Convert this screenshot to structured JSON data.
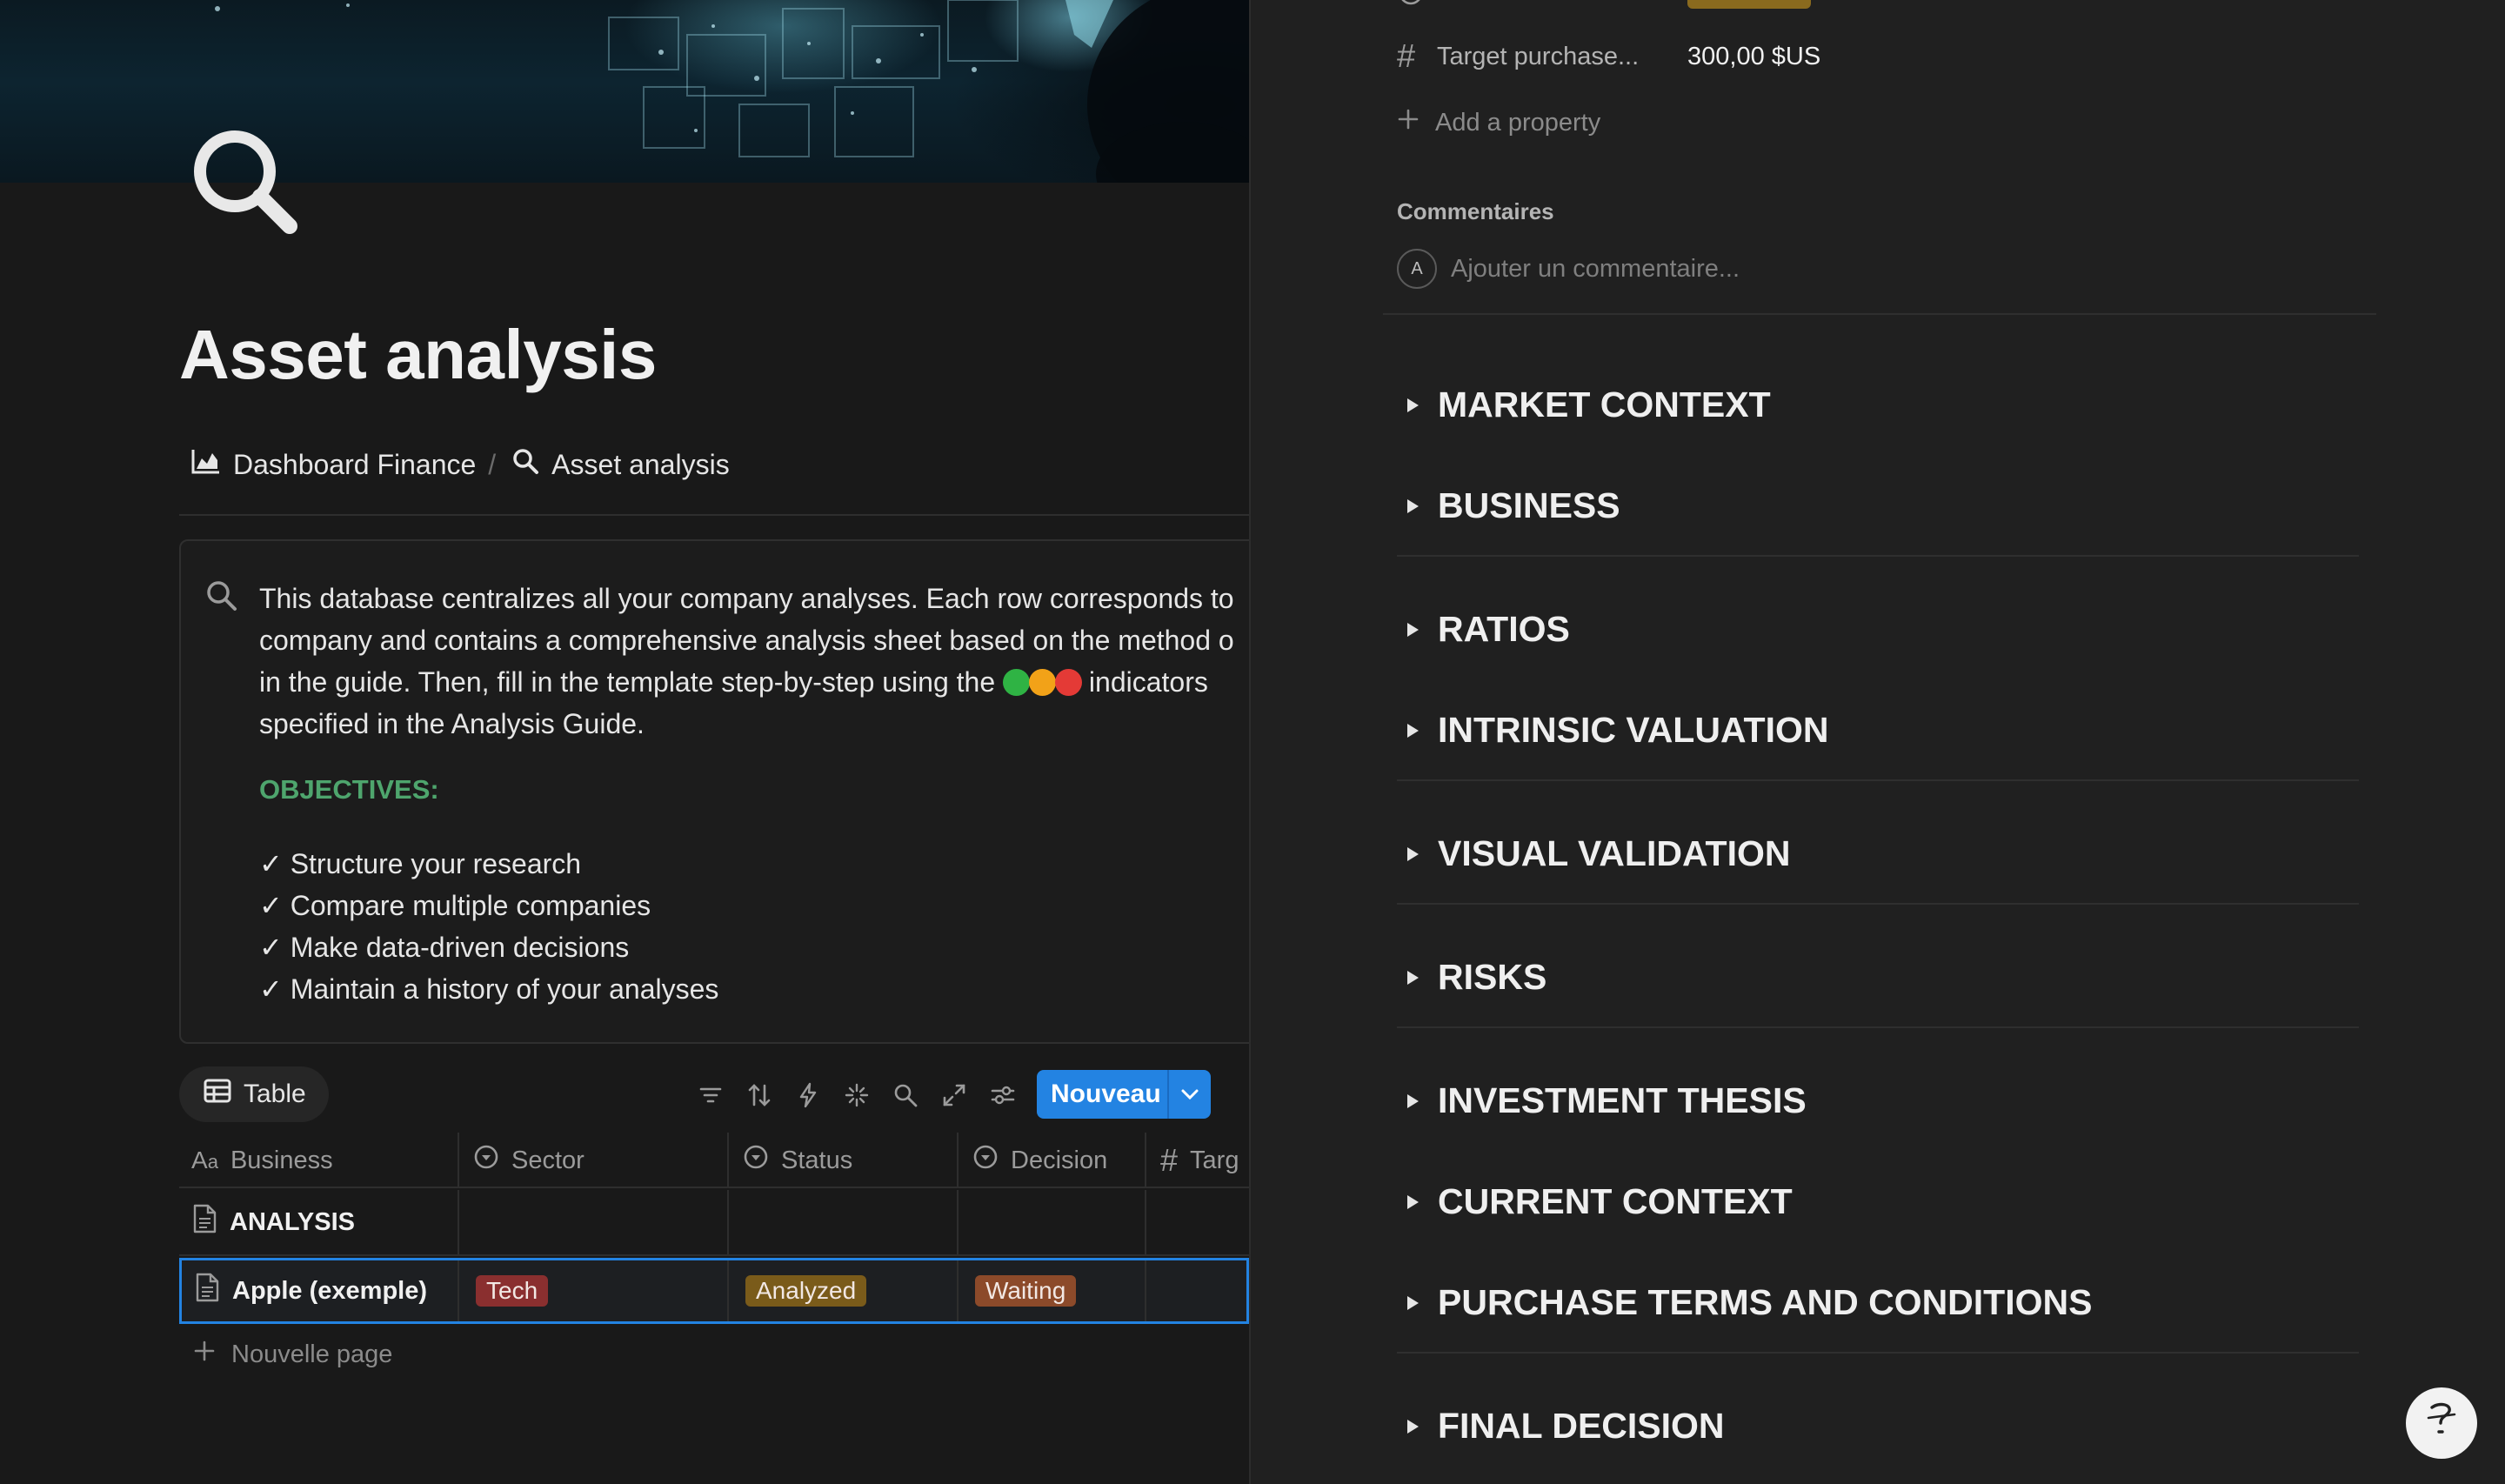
{
  "page": {
    "title": "Asset analysis",
    "icon": "search-icon"
  },
  "breadcrumb": [
    {
      "label": "Dashboard Finance",
      "icon": "chart-icon"
    },
    {
      "label": "Asset analysis",
      "icon": "search-icon"
    }
  ],
  "breadcrumb_separator": "/",
  "callout": {
    "lines": [
      "This database centralizes all your company analyses. Each row corresponds to",
      "company and contains a comprehensive analysis sheet based on the method o",
      "in the guide. Then, fill in the template step-by-step using the",
      "specified in the Analysis Guide."
    ],
    "indicators_suffix": " indicators",
    "indicator_colors": [
      "#2fb344",
      "#f2a218",
      "#e43a36"
    ],
    "objectives_title": "OBJECTIVES:",
    "objectives_color": "#4ea56d",
    "objectives": [
      "✓ Structure your research",
      "✓ Compare multiple companies",
      "✓ Make data-driven decisions",
      "✓ Maintain a history of your analyses"
    ]
  },
  "view": {
    "tab_label": "Table",
    "new_button": "Nouveau",
    "accent": "#2383e2"
  },
  "table": {
    "columns": [
      {
        "label": "Business",
        "icon": "title-aa-icon"
      },
      {
        "label": "Sector",
        "icon": "select-icon"
      },
      {
        "label": "Status",
        "icon": "select-icon"
      },
      {
        "label": "Decision",
        "icon": "select-icon"
      },
      {
        "label": "Targ",
        "icon": "number-hash-icon"
      }
    ],
    "rows": [
      {
        "name": "ANALYSIS",
        "sector": "",
        "status": "",
        "decision": ""
      },
      {
        "name": "Apple (exemple)",
        "sector": "Tech",
        "status": "Analyzed",
        "decision": "Waiting"
      }
    ],
    "tag_colors": {
      "Tech": "#8a2f2f",
      "Analyzed": "#7a5b1a",
      "Waiting": "#8c4a2a"
    },
    "new_page": "Nouvelle page"
  },
  "panel": {
    "target_label": "Target purchase...",
    "target_value": "300,00 $US",
    "add_property": "Add a property",
    "comments_label": "Commentaires",
    "comment_avatar": "A",
    "comment_placeholder": "Ajouter un commentaire...",
    "sections": [
      "MARKET CONTEXT",
      "BUSINESS",
      "RATIOS",
      "INTRINSIC VALUATION",
      "VISUAL VALIDATION",
      "RISKS",
      "INVESTMENT THESIS",
      "CURRENT CONTEXT",
      "PURCHASE TERMS AND CONDITIONS",
      "FINAL DECISION"
    ]
  },
  "help": {
    "glyph": "?"
  }
}
